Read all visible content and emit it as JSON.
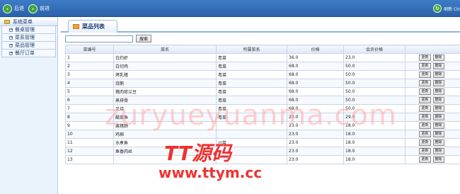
{
  "topbar": {
    "back_label": "后退",
    "forward_label": "前进",
    "refresh_label": "刷新 Ctr"
  },
  "sidebar": {
    "title": "系统菜单",
    "items": [
      {
        "label": "餐桌管理"
      },
      {
        "label": "菜系管理"
      },
      {
        "label": "菜品管理"
      },
      {
        "label": "餐厅订单"
      }
    ]
  },
  "main": {
    "tab_title": "菜品列表",
    "search": {
      "value": "",
      "button_label": "搜索"
    },
    "table": {
      "headers": [
        "菜编号",
        "菜名",
        "所属菜系",
        "价格",
        "会员价格",
        ""
      ],
      "rows": [
        [
          "1",
          "白灼虾",
          "粤菜",
          "36.0",
          "23.0"
        ],
        [
          "2",
          "白切鸡",
          "粤菜",
          "68.0",
          "50.0"
        ],
        [
          "3",
          "烤乳猪",
          "粤菜",
          "68.0",
          "50.0"
        ],
        [
          "4",
          "烧鹅",
          "粤菜",
          "68.0",
          "50.0"
        ],
        [
          "5",
          "猪肉荷兰豆",
          "粤菜",
          "68.0",
          "50.0"
        ],
        [
          "6",
          "蒸排骨",
          "粤菜",
          "68.0",
          "50.0"
        ],
        [
          "7",
          "叉烧",
          "粤菜",
          "68.0",
          "50.0"
        ],
        [
          "8",
          "酸菜鱼",
          "粤菜",
          "23.0",
          "29.0"
        ],
        [
          "9",
          "酱猪蹄",
          "",
          "23.0",
          "18.0"
        ],
        [
          "10",
          "鸡柳",
          "",
          "23.0",
          "18.0"
        ],
        [
          "11",
          "水煮鱼",
          "川菜",
          "23.0",
          "18.0"
        ],
        [
          "12",
          "鱼香肉丝",
          "",
          "23.0",
          "18.0"
        ],
        [
          "13",
          "",
          "",
          "23.0",
          "18.0"
        ]
      ],
      "actions": {
        "update": "更新",
        "delete": "删除"
      }
    }
  },
  "watermarks": {
    "line1": "zuryueyuanma.com",
    "line2": "TT源码",
    "line3": "www.ttym.cc"
  }
}
